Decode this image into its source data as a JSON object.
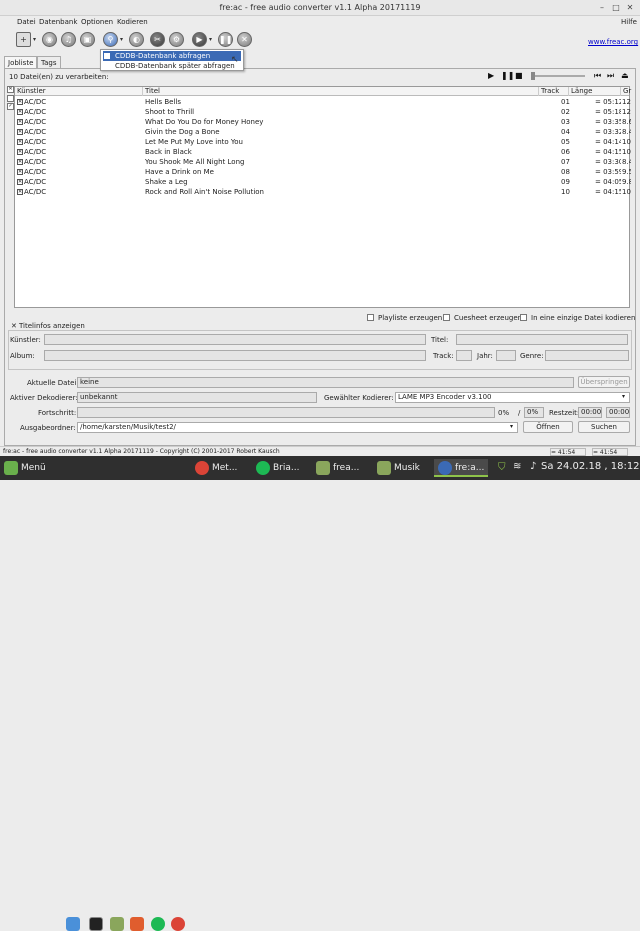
{
  "window": {
    "title": "fre:ac - free audio converter v1.1 Alpha 20171119",
    "minimize": "–",
    "maximize": "□",
    "close": "✕"
  },
  "menu": {
    "file": "Datei",
    "database": "Datenbank",
    "options": "Optionen",
    "encode": "Kodieren",
    "help": "Hilfe"
  },
  "toolbar": {
    "link": "www.freac.org"
  },
  "dropdown": {
    "item1": "CDDB-Datenbank abfragen",
    "item2": "CDDB-Datenbank später abfragen"
  },
  "tabs": {
    "joblist": "Jobliste",
    "tags": "Tags"
  },
  "joblist": {
    "count": "10 Datei(en) zu verarbeiten:",
    "columns": {
      "artist": "Künstler",
      "title": "Titel",
      "track": "Track",
      "length": "Länge",
      "size": "Gr"
    },
    "rows": [
      {
        "artist": "AC/DC",
        "title": "Hells Bells",
        "track": "01",
        "length": "= 05:12",
        "size": "12"
      },
      {
        "artist": "AC/DC",
        "title": "Shoot to Thrill",
        "track": "02",
        "length": "= 05:18",
        "size": "12"
      },
      {
        "artist": "AC/DC",
        "title": "What Do You Do for Money Honey",
        "track": "03",
        "length": "= 03:35",
        "size": "8.6"
      },
      {
        "artist": "AC/DC",
        "title": "Givin the Dog a Bone",
        "track": "04",
        "length": "= 03:32",
        "size": "8.4"
      },
      {
        "artist": "AC/DC",
        "title": "Let Me Put My Love into You",
        "track": "05",
        "length": "= 04:14",
        "size": "10"
      },
      {
        "artist": "AC/DC",
        "title": "Back in Black",
        "track": "06",
        "length": "= 04:15",
        "size": "10"
      },
      {
        "artist": "AC/DC",
        "title": "You Shook Me All Night Long",
        "track": "07",
        "length": "= 03:30",
        "size": "8.4"
      },
      {
        "artist": "AC/DC",
        "title": "Have a Drink on Me",
        "track": "08",
        "length": "= 03:59",
        "size": "9.5"
      },
      {
        "artist": "AC/DC",
        "title": "Shake a Leg",
        "track": "09",
        "length": "= 04:05",
        "size": "9.8"
      },
      {
        "artist": "AC/DC",
        "title": "Rock and Roll Ain't Noise Pollution",
        "track": "10",
        "length": "= 04:15",
        "size": "10"
      }
    ]
  },
  "options": {
    "playlist": "Playliste erzeugen",
    "cuesheet": "Cuesheet erzeugen",
    "single_file": "In eine einzige Datei kodieren"
  },
  "titleinfo": {
    "toggle": "Titelinfos anzeigen",
    "artist": "Künstler:",
    "title": "Titel:",
    "album": "Album:",
    "track": "Track:",
    "year": "Jahr:",
    "genre": "Genre:"
  },
  "status": {
    "current_file_label": "Aktuelle Datei:",
    "current_file": "keine",
    "skip": "Überspringen",
    "decoder_label": "Aktiver Dekodierer:",
    "decoder": "unbekannt",
    "encoder_label": "Gewählter Kodierer:",
    "encoder": "LAME MP3 Encoder v3.100",
    "progress_label": "Fortschritt:",
    "progress1": "0%",
    "slash": "/",
    "progress2": "0%",
    "remaining_label": "Restzeit:",
    "time1": "00:00",
    "time2": "00:00",
    "output_label": "Ausgabeordner:",
    "output": "/home/karsten/Musik/test2/",
    "open": "Öffnen",
    "browse": "Suchen"
  },
  "statusbar": {
    "text": "fre:ac - free audio converter v1.1 Alpha 20171119 - Copyright (C) 2001-2017 Robert Kausch",
    "t1": "= 41:54",
    "t2": "= 41:54"
  },
  "taskbar": {
    "menu": "Menü",
    "met": "Met...",
    "bria": "Bria...",
    "frea": "frea...",
    "musik": "Musik",
    "freac_active": "fre:a...",
    "clock": "Sa 24.02.18 , 18:12"
  }
}
